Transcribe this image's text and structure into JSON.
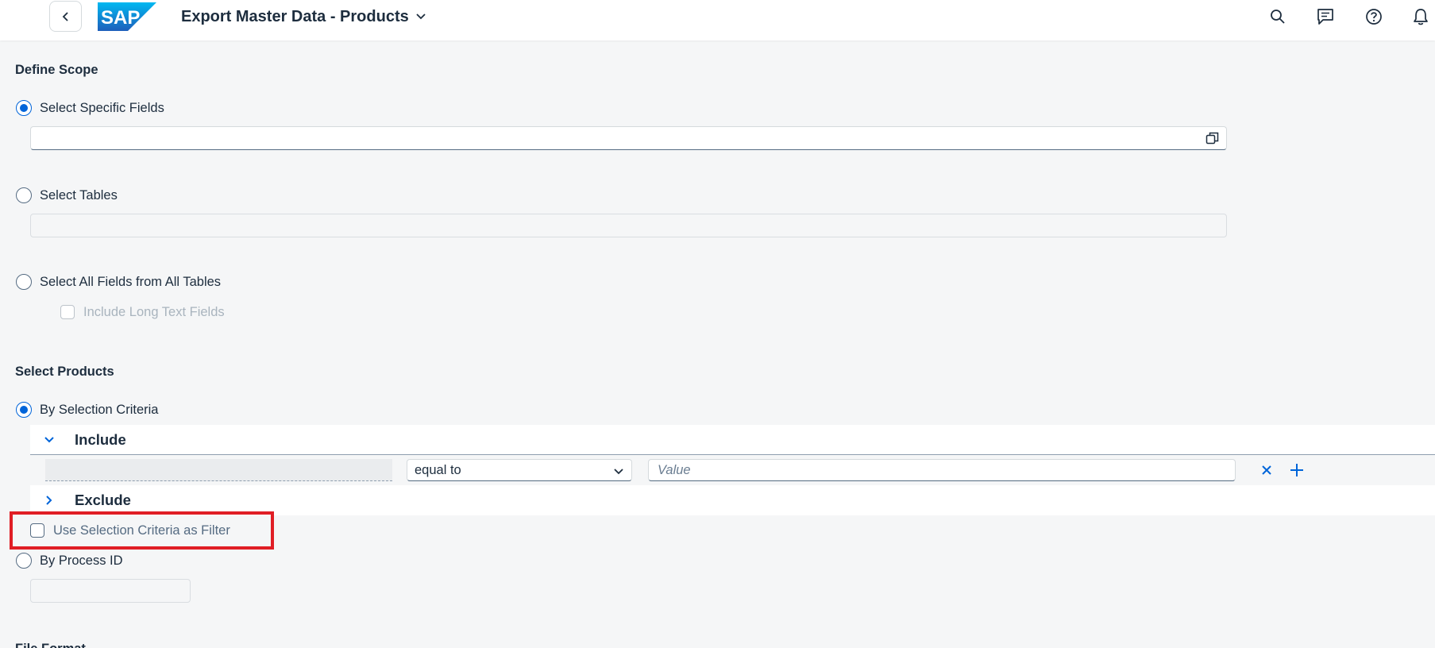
{
  "header": {
    "app_title": "Export Master Data - Products",
    "logo_text": "SAP",
    "icons": [
      "back-icon",
      "chevron-down-icon",
      "search-icon",
      "feedback-icon",
      "help-icon",
      "notification-icon"
    ]
  },
  "define_scope": {
    "title": "Define Scope",
    "options": [
      {
        "label": "Select Specific Fields",
        "selected": true
      },
      {
        "label": "Select Tables",
        "selected": false
      },
      {
        "label": "Select All Fields from All Tables",
        "selected": false
      }
    ],
    "include_long_text_label": "Include Long Text Fields"
  },
  "select_products": {
    "title": "Select Products",
    "by_selection_criteria_label": "By Selection Criteria",
    "include_label": "Include",
    "exclude_label": "Exclude",
    "operator_value": "equal to",
    "value_placeholder": "Value",
    "use_as_filter_label": "Use Selection Criteria as Filter",
    "by_process_id_label": "By Process ID"
  },
  "next_section_title_partial": "File Format",
  "colors": {
    "accent": "#0064d9",
    "highlight": "#e01e25",
    "background": "#f5f6f7"
  }
}
